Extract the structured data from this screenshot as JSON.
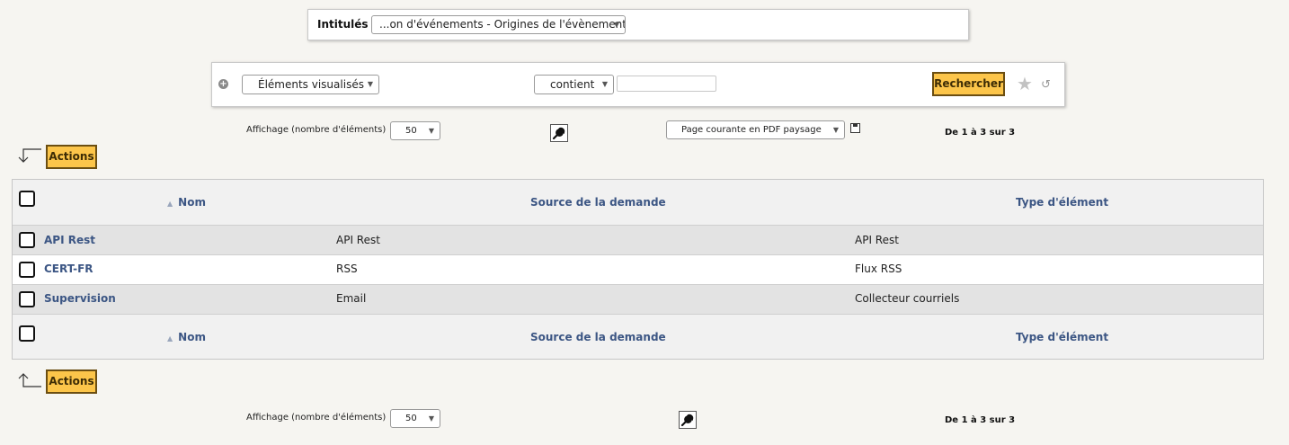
{
  "labels_panel": {
    "label": "Intitulés",
    "select_value": "...on d'événements - Origines de l'évènement"
  },
  "search": {
    "field_select": "Éléments visualisés",
    "operator_select": "contient",
    "input_value": "",
    "button": "Rechercher"
  },
  "top_toolbar": {
    "display_label": "Affichage (nombre d'éléments)",
    "page_size": "50",
    "export_select": "Page courante en PDF paysage",
    "pager": "De 1 à 3 sur 3"
  },
  "actions_label": "Actions",
  "table": {
    "columns": [
      "Nom",
      "Source de la demande",
      "Type d'élément"
    ],
    "rows": [
      {
        "name": "API Rest",
        "source": "API Rest",
        "type": "API Rest"
      },
      {
        "name": "CERT-FR",
        "source": "RSS",
        "type": "Flux RSS"
      },
      {
        "name": "Supervision",
        "source": "Email",
        "type": "Collecteur courriels"
      }
    ]
  },
  "bottom_toolbar": {
    "display_label": "Affichage (nombre d'éléments)",
    "page_size": "50",
    "pager": "De 1 à 3 sur 3"
  },
  "colors": {
    "background": "#f6f5f1",
    "accent_button": "#fcc54a",
    "link": "#3c5684",
    "row_alt": "#e3e3e3"
  }
}
